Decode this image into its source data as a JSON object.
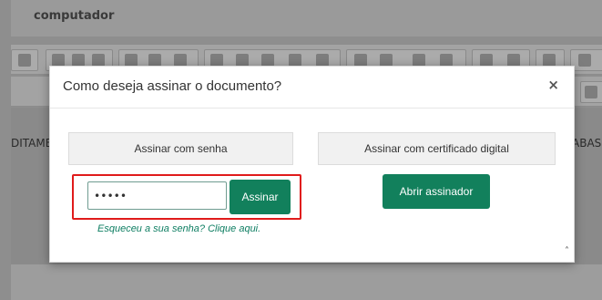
{
  "background": {
    "doc_title": "computador",
    "left_fragment": "DITAME",
    "right_fragment": "ABAS",
    "toolbar_x2": "X₂"
  },
  "modal": {
    "title": "Como deseja assinar o documento?",
    "close_glyph": "×",
    "sign_with_password_label": "Assinar com senha",
    "sign_with_certificate_label": "Assinar com certificado digital",
    "password_value": "•••••",
    "sign_button_label": "Assinar",
    "forgot_password_link": "Esqueceu a sua senha? Clique aqui.",
    "open_signer_label": "Abrir assinador",
    "scroll_glyph": "˄"
  },
  "colors": {
    "primary_green": "#12805c",
    "highlight_red": "#e01b1b",
    "link_green": "#0e7e62"
  }
}
